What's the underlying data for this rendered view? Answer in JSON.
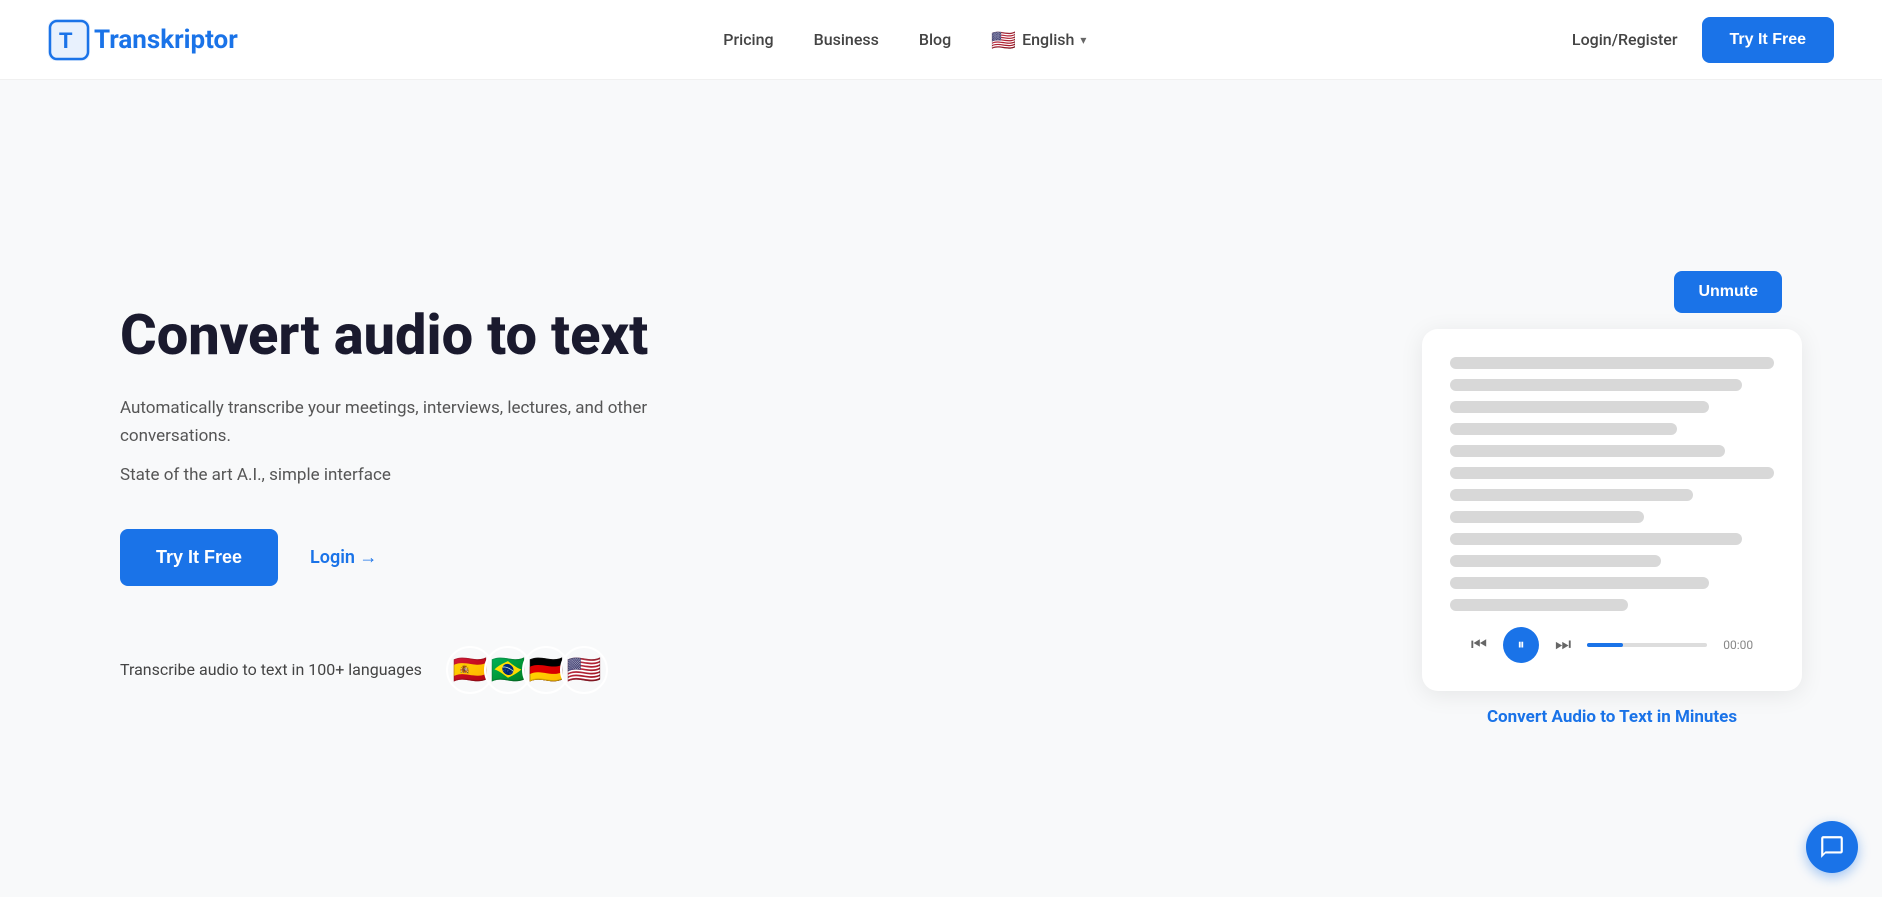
{
  "brand": {
    "name": "Transkriptor",
    "logo_letter": "T"
  },
  "navbar": {
    "pricing_label": "Pricing",
    "business_label": "Business",
    "blog_label": "Blog",
    "language_label": "English",
    "login_label": "Login/Register",
    "cta_label": "Try It Free"
  },
  "hero": {
    "title": "Convert audio to text",
    "subtitle1": "Automatically transcribe your meetings, interviews, lectures, and other conversations.",
    "subtitle2": "State of the art A.I., simple interface",
    "cta_primary": "Try It Free",
    "cta_login": "Login →",
    "languages_text": "Transcribe audio to text in 100+ languages",
    "flags": [
      "🇪🇸",
      "🇧🇷",
      "🇩🇪",
      "🇺🇸"
    ]
  },
  "demo": {
    "unmute_label": "Unmute",
    "convert_text": "Convert Audio to Text in Minutes",
    "time": "00:00",
    "progress_percent": 30
  },
  "icons": {
    "chat": "chat-icon",
    "chevron_down": "▾",
    "play": "⏸",
    "prev": "⏮",
    "next": "⏭"
  }
}
